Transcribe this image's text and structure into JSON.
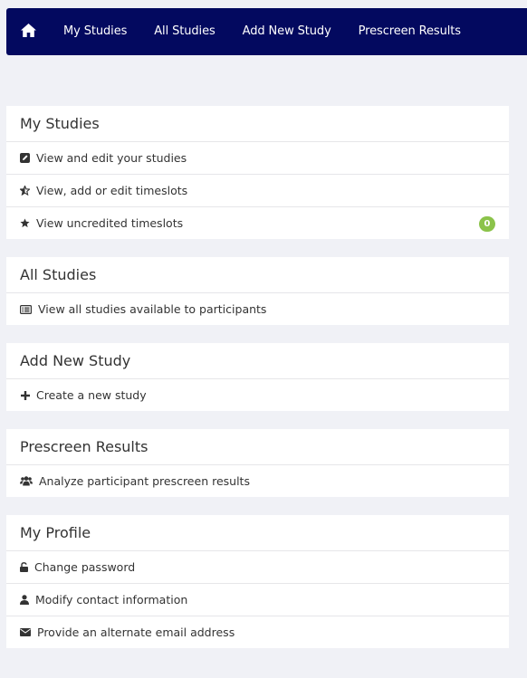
{
  "nav": {
    "home_icon": "home-icon",
    "items": [
      "My Studies",
      "All Studies",
      "Add New Study",
      "Prescreen Results"
    ]
  },
  "colors": {
    "navbar": "#03095f",
    "badge": "#8bc34a",
    "background": "#f0f1f6"
  },
  "panels": {
    "my_studies": {
      "title": "My Studies",
      "rows": [
        {
          "icon": "edit-icon",
          "label": "View and edit your studies"
        },
        {
          "icon": "star-half-icon",
          "label": "View, add or edit timeslots"
        },
        {
          "icon": "star-icon",
          "label": "View uncredited timeslots",
          "badge": "0"
        }
      ]
    },
    "all_studies": {
      "title": "All Studies",
      "rows": [
        {
          "icon": "list-alt-icon",
          "label": "View all studies available to participants"
        }
      ]
    },
    "add_new_study": {
      "title": "Add New Study",
      "rows": [
        {
          "icon": "plus-icon",
          "label": "Create a new study"
        }
      ]
    },
    "prescreen_results": {
      "title": "Prescreen Results",
      "rows": [
        {
          "icon": "users-icon",
          "label": "Analyze participant prescreen results"
        }
      ]
    },
    "my_profile": {
      "title": "My Profile",
      "rows": [
        {
          "icon": "unlock-icon",
          "label": "Change password"
        },
        {
          "icon": "user-icon",
          "label": "Modify contact information"
        },
        {
          "icon": "envelope-icon",
          "label": "Provide an alternate email address"
        }
      ]
    }
  }
}
